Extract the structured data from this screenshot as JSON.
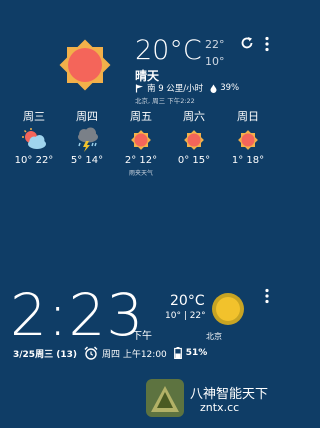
{
  "current": {
    "temp": "20°C",
    "hi": "22°",
    "lo": "10°",
    "condition": "晴天",
    "wind": "南 9 公里/小时",
    "humidity": "39%",
    "location_time": "北京, 周三 下午2:22"
  },
  "forecast": [
    {
      "day": "周三",
      "icon": "partly-cloudy-icon",
      "temps": "10° 22°",
      "note": ""
    },
    {
      "day": "周四",
      "icon": "thunderstorm-icon",
      "temps": "5° 14°",
      "note": ""
    },
    {
      "day": "周五",
      "icon": "sun-icon",
      "temps": "2° 12°",
      "note": "雨夹天气"
    },
    {
      "day": "周六",
      "icon": "sun-icon",
      "temps": "0° 15°",
      "note": ""
    },
    {
      "day": "周日",
      "icon": "sun-icon",
      "temps": "1° 18°",
      "note": ""
    }
  ],
  "clock": {
    "time": "2:23",
    "ampm": "下午",
    "temp": "20°C",
    "hilo": "10° | 22°",
    "location": "北京",
    "date": "3/25周三 (13)",
    "alarm": "周四 上午12:00",
    "battery": "51%"
  },
  "watermark": {
    "cn": "八神智能天下",
    "url": "zntx.cc"
  },
  "colors": {
    "background": "#0f3d66",
    "sun_body": "#f4655a",
    "sun_rays": "#f2b04a",
    "small_sun": "#f2c22c"
  }
}
